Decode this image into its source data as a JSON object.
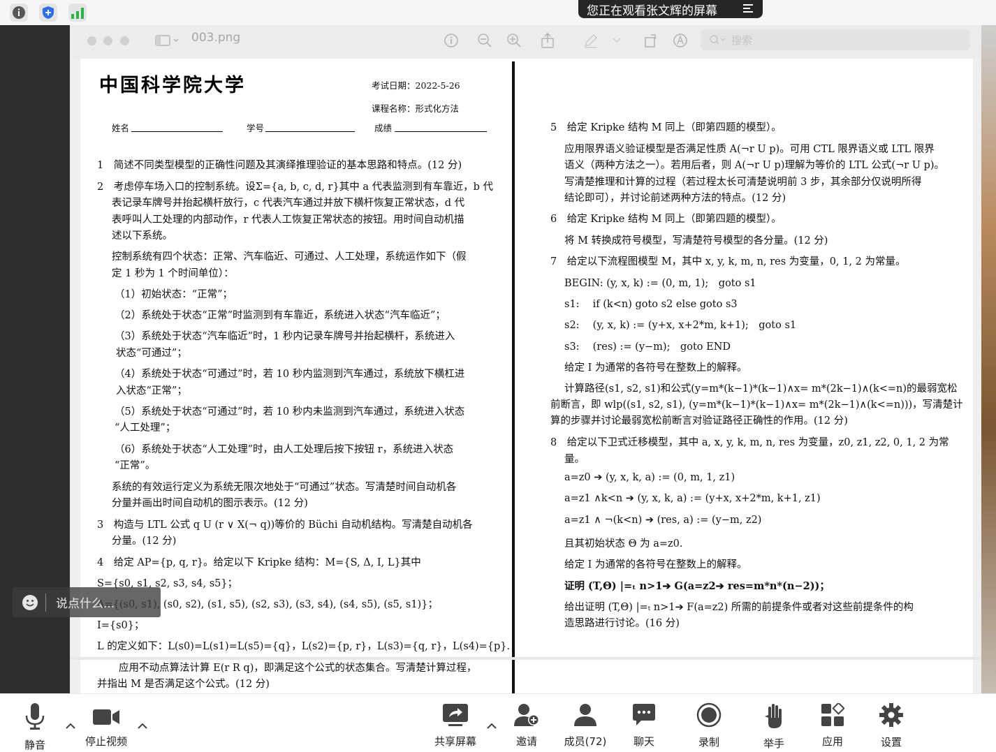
{
  "topbar": {
    "share_banner": "您正在观看张文辉的屏幕"
  },
  "preview": {
    "filename": "003.png",
    "search_placeholder": "搜索"
  },
  "exam": {
    "school": "中国科学院大学",
    "exam_date": "考试日期：2022-5-26",
    "course": "课程名称：形式化方法",
    "name_label": "姓名",
    "id_label": "学号",
    "score_label": "成绩",
    "left_lines": [
      "1　简述不同类型模型的正确性问题及其演绎推理验证的基本思路和特点。(12 分)",
      "2　考虑停车场入口的控制系统。设Σ={a, b, c, d, r}其中 a 代表监测到有车靠近，b 代",
      "表记录车牌号并抬起横杆放行，c 代表汽车通过并放下横杆恢复正常状态，d 代",
      "表呼叫人工处理的内部动作，r 代表人工恢复正常状态的按钮。用时间自动机描",
      "述以下系统。",
      "控制系统有四个状态：正常、汽车临近、可通过、人工处理，系统运作如下（假",
      "定 1 秒为 1 个时间单位）：",
      "（1）初始状态：“正常”；",
      "（2）系统处于状态“正常”时监测到有车靠近，系统进入状态“汽车临近”；",
      "（3）系统处于状态“汽车临近”时，1 秒内记录车牌号并抬起横杆，系统进入",
      "状态“可通过”；",
      "（4）系统处于状态“可通过”时，若 10 秒内监测到汽车通过，系统放下横杠进",
      "入状态“正常”；",
      "（5）系统处于状态“可通过”时，若 10 秒内未监测到汽车通过，系统进入状态",
      "“人工处理”；",
      "（6）系统处于状态“人工处理”时，由人工处理后按下按钮 r，系统进入状态",
      "“正常”。",
      "系统的有效运行定义为系统无限次地处于“可通过”状态。写清楚时间自动机各",
      "分量并画出时间自动机的图示表示。(12 分)",
      "3　构造与 LTL 公式 q U (r ∨ X(¬ q))等价的 Büchi 自动机结构。写清楚自动机各",
      "分量。(12 分)",
      "4　给定 AP={p, q, r}。给定以下 Kripke 结构：M={S, Δ, I, L}其中",
      "S={s0, s1, s2, s3, s4, s5}；",
      "Δ={(s0, s1), (s0, s2), (s1, s5), (s2, s3), (s3, s4), (s4, s5), (s5, s1)}；",
      "I={s0}；",
      "L 的定义如下：L(s0)=L(s1)=L(s5)={q}，L(s2)={p, r}，L(s3)={q, r}，L(s4)={p}.",
      "应用不动点算法计算 E(r R q)，即满足这个公式的状态集合。写清楚计算过程，",
      "并指出 M 是否满足这个公式。(12 分)"
    ],
    "right_lines": [
      "5　给定 Kripke 结构 M 同上（即第四题的模型）。",
      "应用限界语义验证模型是否满足性质 A(¬r U p)。可用 CTL 限界语义或 LTL 限界",
      "语义（两种方法之一）。若用后者，则 A(¬r U p)理解为等价的 LTL 公式(¬r U p)。",
      "写清楚推理和计算的过程（若过程太长可清楚说明前 3 步，其余部分仅说明所得",
      "结论即可），并讨论前述两种方法的特点。(12 分)",
      "6　给定 Kripke 结构 M 同上（即第四题的模型）。",
      "将 M 转换成符号模型，写清楚符号模型的各分量。(12 分)",
      "7　给定以下流程图模型 M，其中 x, y, k, m, n, res 为变量，0, 1, 2 为常量。",
      "BEGIN: (y, x, k) := (0, m, 1);　goto s1",
      "s1:　 if (k<n) goto s2 else goto s3",
      "s2:　 (y, x, k) := (y+x, x+2*m, k+1);　goto s1",
      "s3:　 (res) := (y−m);　goto END",
      "给定 I 为通常的各符号在整数上的解释。",
      "计算路径(s1, s2, s1)和公式(y=m*(k−1)*(k−1)∧x= m*(2k−1)∧(k<=n)的最弱宽松",
      "前断言，即 wlp((s1, s2, s1), (y=m*(k−1)*(k−1)∧x= m*(2k−1)∧(k<=n)))，写清楚计",
      "算的步骤并讨论最弱宽松前断言对验证路径正确性的作用。(12 分)",
      "8　给定以下卫式迁移模型，其中 a, x, y, k, m, n, res 为变量，z0, z1, z2, 0, 1, 2 为常",
      "量。",
      "a=z0 ➔ (y, x, k, a) := (0, m, 1, z1)",
      "a=z1 ∧k<n ➔ (y, x, k, a) := (y+x, x+2*m, k+1, z1)",
      "a=z1 ∧ ¬(k<n) ➔ (res, a) := (y−m, z2)",
      "且其初始状态 Θ 为 a=z0.",
      "给定 I 为通常的各符号在整数上的解释。",
      "证明 (T,Θ) |=ₜ n>1➔ G(a=z2➔ res=m*n*(n−2))；",
      "给出证明 (T,Θ) |=ₜ n>1➔ F(a=z2) 所需的前提条件或者对这些前提条件的构",
      "造思路进行讨论。(16 分)"
    ]
  },
  "chat": {
    "placeholder": "说点什么..."
  },
  "toolbar": {
    "mute": "静音",
    "stop_video": "停止视频",
    "share_screen": "共享屏幕",
    "invite": "邀请",
    "members": "成员(72)",
    "chat": "聊天",
    "record": "录制",
    "raise_hand": "举手",
    "apps": "应用",
    "settings": "设置"
  },
  "colors": {
    "banner_bg": "#262626",
    "accent_blue": "#2f6fe4",
    "green": "#2cb24a"
  }
}
